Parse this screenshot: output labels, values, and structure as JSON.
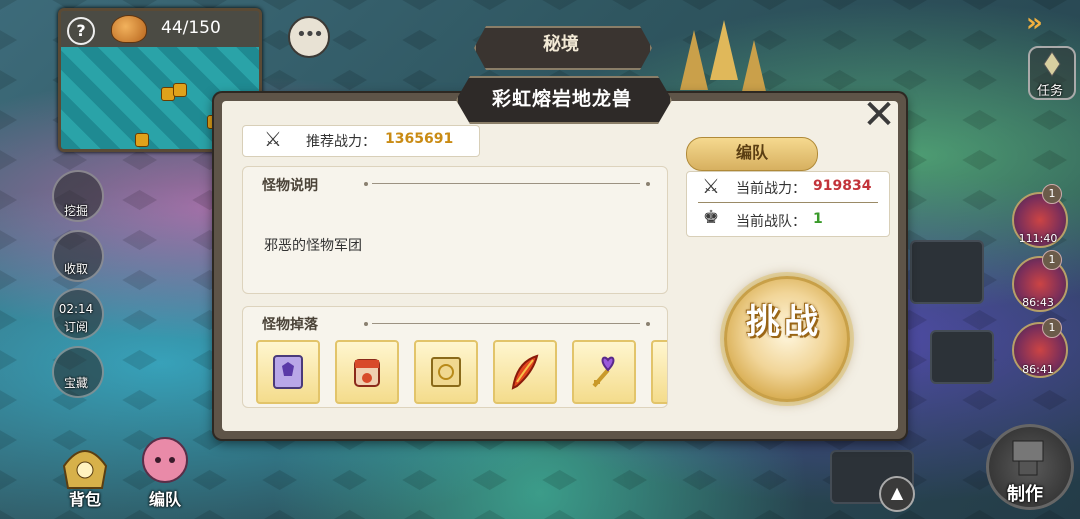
{
  "hud": {
    "stamina": "44/150"
  },
  "left_menu": {
    "dig": "挖掘",
    "collect": "收取",
    "timer": "02:14",
    "timer_sub": "订阅",
    "treasure": "宝藏"
  },
  "bottom_menu": {
    "bag": "背包",
    "team": "编队"
  },
  "right_menu": {
    "task": "任务",
    "timers": [
      {
        "time": "111:40",
        "badge": "1"
      },
      {
        "time": "86:43",
        "badge": "1"
      },
      {
        "time": "86:41",
        "badge": "1"
      }
    ],
    "craft": "制作"
  },
  "dialog": {
    "category": "秘境",
    "title": "彩虹熔岩地龙兽",
    "recommended_label": "推荐战力：",
    "recommended_value": "1365691",
    "monster_desc_title": "怪物说明",
    "monster_desc_text": "邪恶的怪物军团",
    "drops_title": "怪物掉落",
    "drops": [
      {
        "icon": "purple-scroll-icon"
      },
      {
        "icon": "red-scroll-icon"
      },
      {
        "icon": "gold-map-icon"
      },
      {
        "icon": "fire-feather-icon"
      },
      {
        "icon": "heart-key-icon"
      }
    ],
    "team_tab": "编队",
    "current_power_label": "当前战力：",
    "current_power_value": "919834",
    "current_team_label": "当前战队：",
    "current_team_value": "1",
    "challenge": "挑战"
  },
  "colors": {
    "recommended_value": "#c98b14",
    "current_power_value": "#c2333a",
    "current_team_value": "#3a9a2a"
  }
}
